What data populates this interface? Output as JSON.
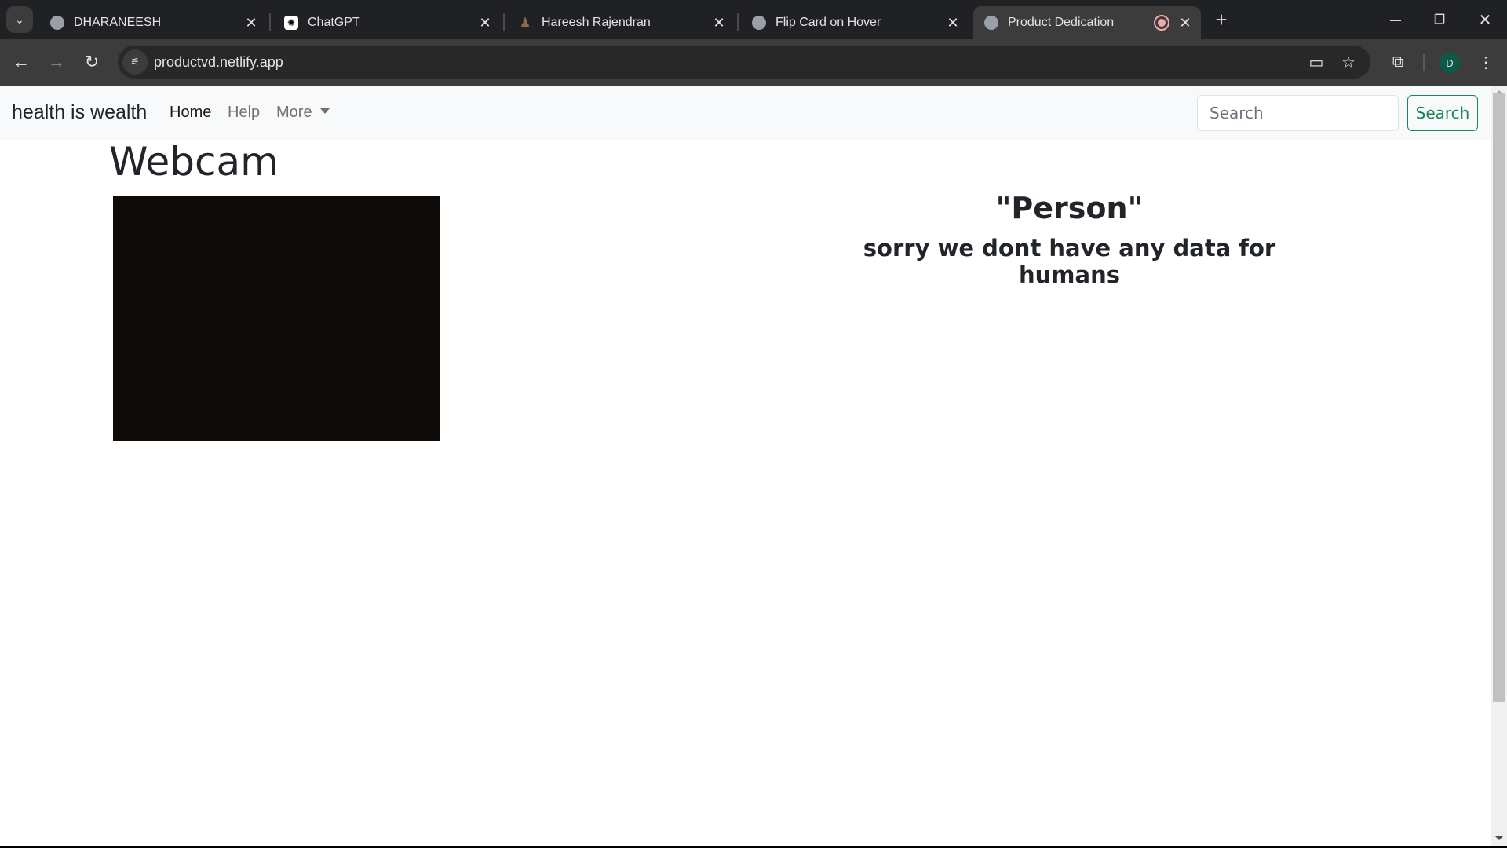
{
  "browser": {
    "tabs": [
      {
        "title": "DHARANEESH",
        "icon": "globe-icon"
      },
      {
        "title": "ChatGPT",
        "icon": "chatgpt-icon"
      },
      {
        "title": "Hareesh Rajendran",
        "icon": "person-avatar-icon"
      },
      {
        "title": "Flip Card on Hover",
        "icon": "globe-icon"
      },
      {
        "title": "Product Dedication",
        "icon": "globe-icon",
        "active": true,
        "recording": true
      }
    ],
    "url": "productvd.netlify.app",
    "profile_initial": "D",
    "colors": {
      "profile_bg": "#0b5a46",
      "recording": "#f2a9a9"
    }
  },
  "navbar": {
    "brand": "health is wealth",
    "links": [
      {
        "label": "Home",
        "active": true
      },
      {
        "label": "Help"
      },
      {
        "label": "More",
        "dropdown": true
      }
    ],
    "search": {
      "placeholder": "Search",
      "value": "",
      "button_label": "Search"
    },
    "colors": {
      "search_button": "#198754"
    }
  },
  "main": {
    "webcam_title": "Webcam",
    "result_title": "\"Person\"",
    "result_message": "sorry we dont have any data for humans"
  },
  "glyphs": {
    "tab_list": "⌄",
    "close": "✕",
    "new_tab": "+",
    "minimize": "—",
    "restore": "❐",
    "win_close": "✕",
    "back": "←",
    "forward": "→",
    "reload": "↻",
    "site_info": "⚟",
    "camera": "▭",
    "star": "☆",
    "extensions": "⧉",
    "menu": "⋮",
    "gpt": "✺",
    "person": "♟"
  }
}
